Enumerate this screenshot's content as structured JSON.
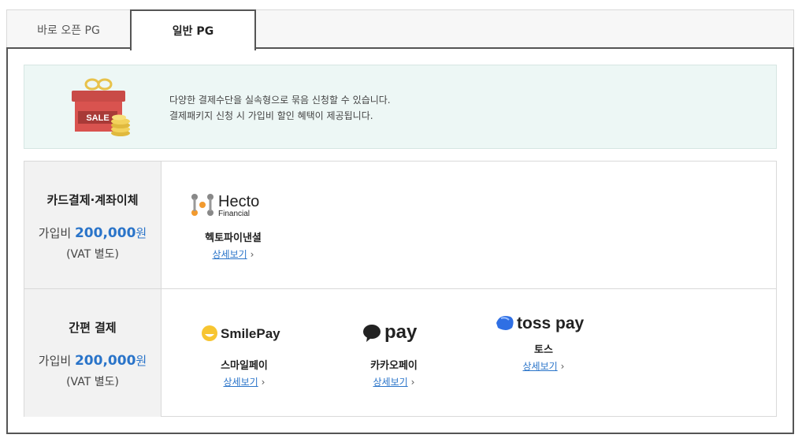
{
  "tabs": [
    {
      "label": "바로 오픈 PG"
    },
    {
      "label": "일반 PG"
    }
  ],
  "banner": {
    "badge": "SALE",
    "line1": "다양한 결제수단을 실속형으로 묶음 신청할 수 있습니다.",
    "line2": "결제패키지 신청 시 가입비 할인 혜택이 제공됩니다."
  },
  "rows": [
    {
      "title": "카드결제·계좌이체",
      "fee_prefix": "가입비",
      "fee_amount": "200,000",
      "fee_unit": "원",
      "vat": "(VAT 별도)",
      "providers": [
        {
          "logo_text": "Hecto",
          "logo_sub": "Financial",
          "name": "헥토파이낸셜",
          "link": "상세보기",
          "chevron": "›"
        }
      ]
    },
    {
      "title": "간편 결제",
      "fee_prefix": "가입비",
      "fee_amount": "200,000",
      "fee_unit": "원",
      "vat": "(VAT 별도)",
      "providers": [
        {
          "logo_text": "SmilePay",
          "name": "스마일페이",
          "link": "상세보기",
          "chevron": "›"
        },
        {
          "logo_text": "pay",
          "name": "카카오페이",
          "link": "상세보기",
          "chevron": "›"
        },
        {
          "logo_text": "toss pay",
          "name": "토스",
          "link": "상세보기",
          "chevron": "›"
        }
      ]
    }
  ],
  "colors": {
    "accent": "#2a74c9",
    "banner_bg": "#edf7f5",
    "gift_red": "#d9534f",
    "coin": "#f3d25c"
  }
}
